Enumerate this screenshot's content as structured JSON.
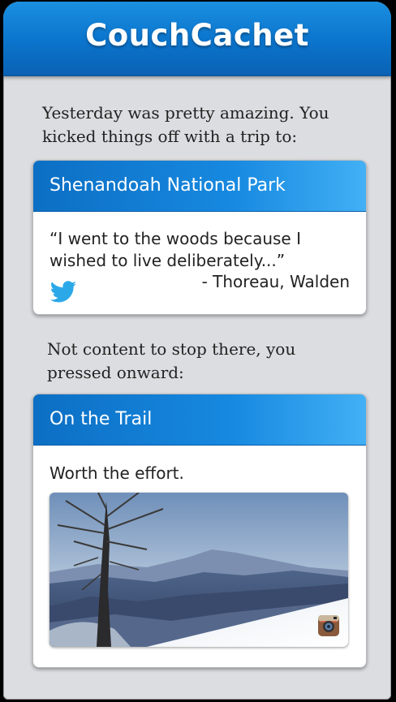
{
  "app": {
    "title": "CouchCachet"
  },
  "intro1": {
    "line1": "Yesterday was pretty amazing. You",
    "line2": "kicked things off with a trip to:"
  },
  "card1": {
    "title": "Shenandoah National Park",
    "quote_line1": "“I went to the woods because I",
    "quote_line2": "wished to live deliberately...”",
    "attribution": "- Thoreau, Walden",
    "source_icon": "twitter-icon"
  },
  "intro2": {
    "line1": "Not content to stop there, you",
    "line2": "pressed onward:"
  },
  "card2": {
    "title": "On the Trail",
    "caption": "Worth the effort.",
    "source_icon": "instagram-icon"
  },
  "colors": {
    "header_blue": "#0b74cc",
    "twitter_blue": "#2ba8e8",
    "background": "#dcdde0"
  }
}
